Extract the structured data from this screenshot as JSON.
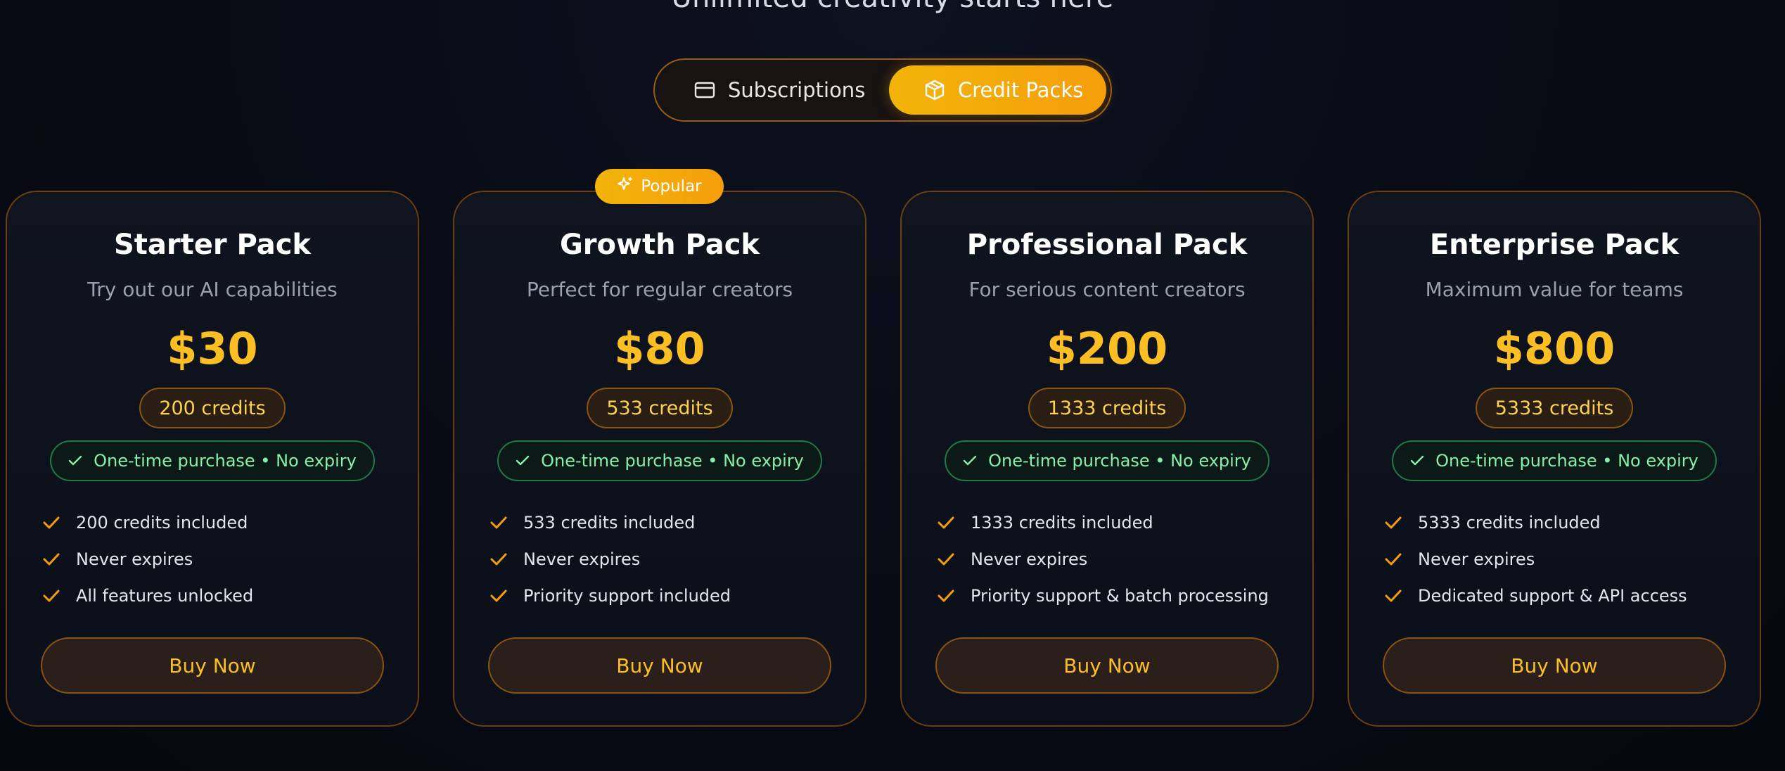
{
  "headline": "Unlimited creativity starts here",
  "toggle": {
    "subscriptions_label": "Subscriptions",
    "subscriptions_icon": "credit-card-icon",
    "credit_packs_label": "Credit Packs",
    "credit_packs_icon": "package-icon",
    "active": "Credit Packs"
  },
  "badge": {
    "label": "Popular",
    "icon": "sparkles-icon"
  },
  "colors": {
    "accent": "#f59e0b",
    "price": "#fbbf24",
    "success": "#86efac",
    "background": "#080b14"
  },
  "packs": [
    {
      "title": "Starter Pack",
      "description": "Try out our AI capabilities",
      "price": "$30",
      "credits": "200 credits",
      "note": "One-time purchase • No expiry",
      "features": [
        "200 credits included",
        "Never expires",
        "All features unlocked"
      ],
      "button": "Buy Now"
    },
    {
      "title": "Growth Pack",
      "description": "Perfect for regular creators",
      "price": "$80",
      "credits": "533 credits",
      "note": "One-time purchase • No expiry",
      "features": [
        "533 credits included",
        "Never expires",
        "Priority support included"
      ],
      "button": "Buy Now"
    },
    {
      "title": "Professional Pack",
      "description": "For serious content creators",
      "price": "$200",
      "credits": "1333 credits",
      "note": "One-time purchase • No expiry",
      "features": [
        "1333 credits included",
        "Never expires",
        "Priority support & batch processing"
      ],
      "button": "Buy Now"
    },
    {
      "title": "Enterprise Pack",
      "description": "Maximum value for teams",
      "price": "$800",
      "credits": "5333 credits",
      "note": "One-time purchase • No expiry",
      "features": [
        "5333 credits included",
        "Never expires",
        "Dedicated support & API access"
      ],
      "button": "Buy Now"
    }
  ]
}
